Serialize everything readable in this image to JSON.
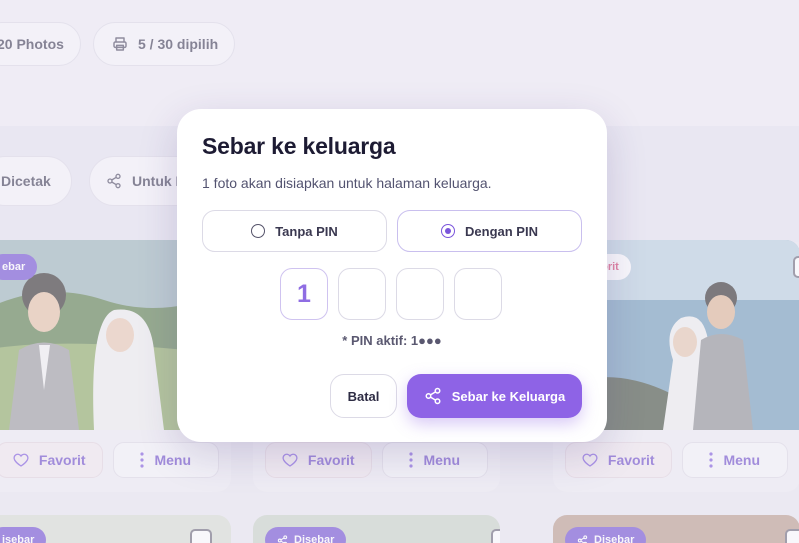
{
  "colors": {
    "accent": "#8e63e6",
    "accent_dark": "#6d4bd0",
    "favorite": "#d63a6a"
  },
  "header": {
    "photos_label": "20 Photos",
    "print_label": "5 / 30 dipilih"
  },
  "filters": {
    "printed_label": "Dicetak",
    "family_label": "Untuk K"
  },
  "cards": [
    {
      "badge": "ebar",
      "favorite_label": "Favorit",
      "menu_label": "Menu"
    },
    {
      "badge": "",
      "favorite_label": "Favorit",
      "menu_label": "Menu"
    },
    {
      "badge": "vorit",
      "favorite_label": "Favorit",
      "menu_label": "Menu"
    }
  ],
  "bottom_cards": [
    {
      "badge": "isebar"
    },
    {
      "badge": "Disebar"
    },
    {
      "badge": "Disebar"
    }
  ],
  "modal": {
    "title": "Sebar ke keluarga",
    "subtitle": "1 foto akan disiapkan untuk halaman keluarga.",
    "options": [
      {
        "label": "Tanpa PIN",
        "selected": false
      },
      {
        "label": "Dengan PIN",
        "selected": true
      }
    ],
    "pin_digits": [
      "1",
      "",
      "",
      ""
    ],
    "pin_note": "* PIN aktif: 1●●●",
    "cancel_label": "Batal",
    "share_label": "Sebar ke Keluarga"
  }
}
